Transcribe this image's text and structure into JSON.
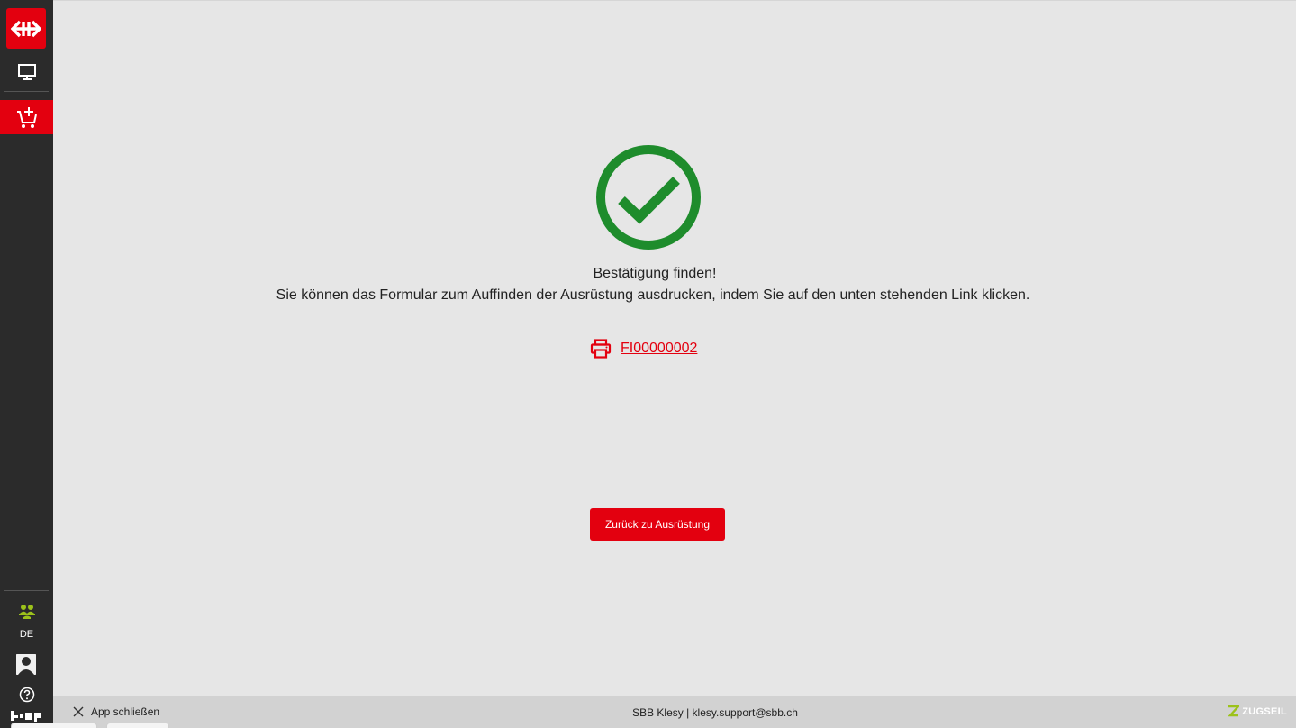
{
  "sidebar": {
    "logo_icon": "sbb-arrows-logo",
    "items": [
      {
        "icon": "monitor-icon",
        "active": false
      },
      {
        "icon": "cart-add-icon",
        "active": true
      }
    ],
    "users_icon": "users-icon",
    "language": "DE",
    "avatar_icon": "user-avatar",
    "help_icon": "help-icon",
    "brand_color": "#e3000f",
    "users_color": "#9cc21b"
  },
  "main": {
    "success_icon": "check-circle-icon",
    "success_color": "#1e8c2c",
    "title": "Bestätigung finden!",
    "message": "Sie können das Formular zum Auffinden der Ausrüstung ausdrucken, indem Sie auf den unten stehenden Link klicken.",
    "document_link": "FI00000002",
    "print_icon": "printer-icon",
    "back_button": "Zurück zu Ausrüstung"
  },
  "footer": {
    "close_label": "App schließen",
    "center_text": "SBB Klesy | klesy.support@sbb.ch",
    "brand": "ZUGSEIL"
  }
}
